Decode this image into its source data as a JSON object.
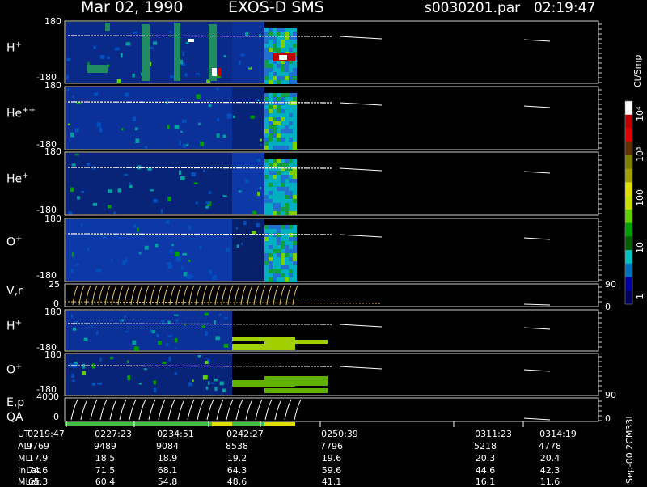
{
  "header": {
    "date": "Mar 02, 1990",
    "instrument": "EXOS-D SMS",
    "file": "s0030201.par",
    "time": "02:19:47"
  },
  "colorbar": {
    "unit": "Ct/Smp",
    "tick_labels": [
      "10⁴",
      "10³",
      "100",
      "10",
      "1"
    ],
    "colors": [
      "#ffffff",
      "#c00000",
      "#e00000",
      "#603000",
      "#808000",
      "#a0a000",
      "#e0e000",
      "#c8e000",
      "#60d000",
      "#00a000",
      "#006000",
      "#00c0c0",
      "#0070c0",
      "#0000a0",
      "#000060"
    ]
  },
  "panels": [
    {
      "name": "H+",
      "label_main": "H",
      "label_sup": "+",
      "ytop": "180",
      "ybot": "-180"
    },
    {
      "name": "He++",
      "label_main": "He",
      "label_sup": "++",
      "ytop": "180",
      "ybot": "-180"
    },
    {
      "name": "He+",
      "label_main": "He",
      "label_sup": "+",
      "ytop": "180",
      "ybot": "-180"
    },
    {
      "name": "O+",
      "label_main": "O",
      "label_sup": "+",
      "ytop": "180",
      "ybot": "-180"
    },
    {
      "name": "V,r",
      "label_main": "V,r",
      "label_sup": "",
      "ytop": "25",
      "ybot": "0",
      "rtop": "90",
      "rbot": "0"
    },
    {
      "name": "H+ (2)",
      "label_main": "H",
      "label_sup": "+",
      "ytop": "180",
      "ybot": "-180"
    },
    {
      "name": "O+ (2)",
      "label_main": "O",
      "label_sup": "+",
      "ytop": "180",
      "ybot": "-180"
    },
    {
      "name": "E,p QA",
      "label_main": "E,p",
      "label_sub": "QA",
      "ytop": "4000",
      "ybot": "0",
      "rtop": "90",
      "rbot": "0"
    }
  ],
  "chart_data": {
    "type": "heatmap",
    "title": "Mar 02, 1990   EXOS-D SMS",
    "xlabel": "UT",
    "x_ticks": [
      "0219:47",
      "0227:23",
      "0234:51",
      "0242:27",
      "0250:39",
      "0311:23",
      "0314:19"
    ],
    "rows": [
      {
        "name": "UT",
        "values": [
          "0219:47",
          "0227:23",
          "0234:51",
          "0242:27",
          "0250:39",
          "0311:23",
          "0314:19"
        ]
      },
      {
        "name": "ALT",
        "values": [
          "9769",
          "9489",
          "9084",
          "8538",
          "7796",
          "5218",
          "4778"
        ]
      },
      {
        "name": "MLT",
        "values": [
          "17.9",
          "18.5",
          "18.9",
          "19.2",
          "19.6",
          "20.3",
          "20.4"
        ]
      },
      {
        "name": "InLat",
        "values": [
          "74.6",
          "71.5",
          "68.1",
          "64.3",
          "59.6",
          "44.6",
          "42.3"
        ]
      },
      {
        "name": "MLat",
        "values": [
          "65.3",
          "60.4",
          "54.8",
          "48.6",
          "41.1",
          "16.1",
          "11.6"
        ]
      }
    ]
  },
  "footer": {
    "version": "Sep-00 2CM33L"
  }
}
